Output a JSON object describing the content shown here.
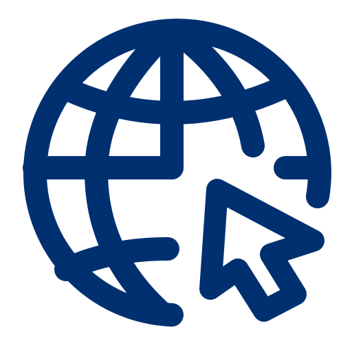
{
  "icon": {
    "name": "globe-with-cursor-icon",
    "color": "#003070",
    "background": "#ffffff"
  }
}
